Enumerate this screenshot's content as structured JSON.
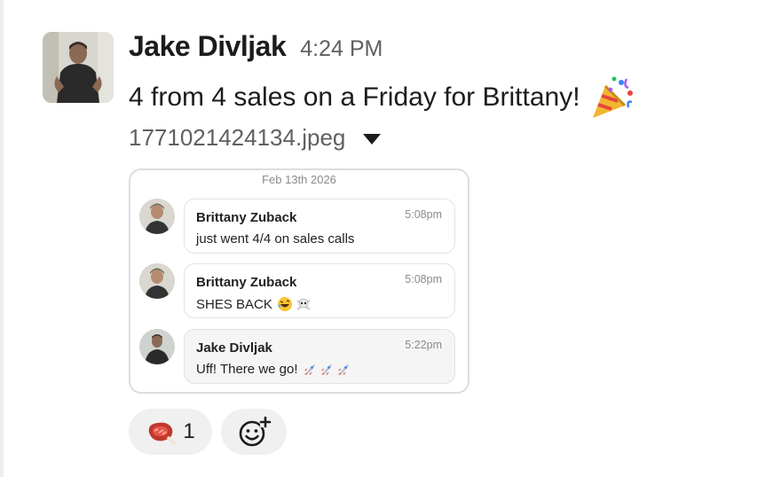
{
  "message": {
    "sender": "Jake Divljak",
    "time": "4:24 PM",
    "text": "4 from 4 sales on a Friday for Brittany!",
    "emoji": "party-popper"
  },
  "attachment": {
    "filename": "1771021424134.jpeg",
    "date_header": "Feb 13th 2026",
    "messages": [
      {
        "name": "Brittany Zuback",
        "time": "5:08pm",
        "text": "just went 4/4 on sales calls",
        "emojis": []
      },
      {
        "name": "Brittany Zuback",
        "time": "5:08pm",
        "text": "SHES BACK",
        "emojis": [
          "rofl-face",
          "skull-crossbones"
        ]
      },
      {
        "name": "Jake Divljak",
        "time": "5:22pm",
        "text": "Uff! There we go!",
        "emojis": [
          "rocket",
          "rocket",
          "rocket"
        ]
      }
    ]
  },
  "reactions": [
    {
      "emoji": "steak-meat",
      "count": "1"
    }
  ],
  "add_reaction_icon": "add-reaction-icon"
}
